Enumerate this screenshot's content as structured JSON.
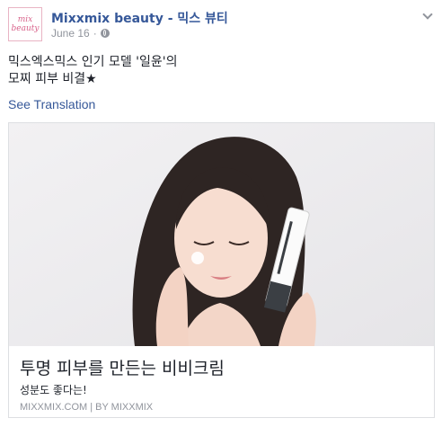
{
  "post": {
    "page_name": "Mixxmix beauty - 믹스 뷰티",
    "avatar_text_line1": "mix",
    "avatar_text_line2": "beauty",
    "date": "June 16",
    "separator": "·",
    "privacy_icon": "globe-icon",
    "menu_icon": "chevron-down-icon",
    "text_line1": "믹스엑스믹스 인기 모델 '일윤'의",
    "text_line2": "모찌 피부 비결★",
    "see_translation": "See Translation"
  },
  "link_card": {
    "title": "투명 피부를 만든는 비비크림",
    "description": "성분도 좋다는!",
    "source": "MIXXMIX.COM | BY MIXXMIX"
  },
  "colors": {
    "link_blue": "#365899",
    "meta_gray": "#90949c",
    "avatar_pink": "#d8628a",
    "border": "#dddfe2"
  }
}
